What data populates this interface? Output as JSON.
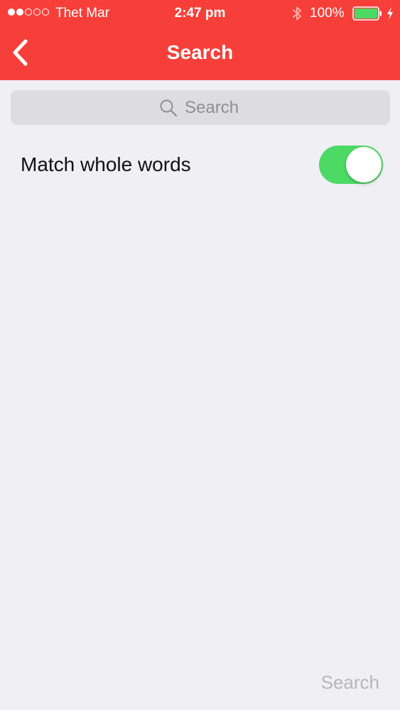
{
  "status_bar": {
    "carrier": "Thet Mar",
    "time": "2:47 pm",
    "battery_percent": "100%",
    "signal_bars_filled": 2,
    "signal_bars_total": 5,
    "battery_level": 1.0,
    "icons": [
      "signal-dots-icon",
      "bluetooth-icon",
      "battery-icon",
      "charging-bolt-icon"
    ]
  },
  "nav": {
    "title": "Search",
    "back_icon": "chevron-left-icon"
  },
  "search": {
    "placeholder": "Search",
    "value": "",
    "icon": "magnifier-icon"
  },
  "options": {
    "match_whole_words_label": "Match whole words",
    "match_whole_words_on": true
  },
  "footer": {
    "search_button_label": "Search"
  },
  "colors": {
    "accent": "#f73f3a",
    "toggle_on": "#4cd964",
    "background": "#efeff4",
    "search_field_bg": "#dcdce1",
    "disabled_text": "#b6b6bb"
  }
}
